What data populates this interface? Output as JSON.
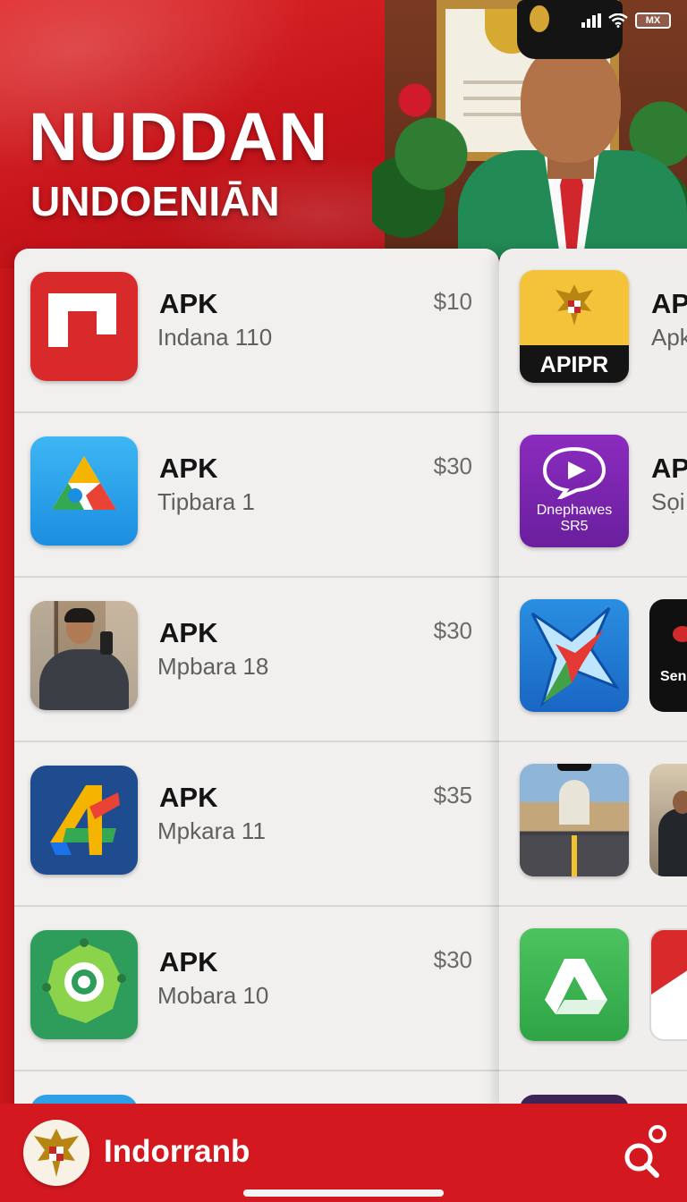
{
  "banner": {
    "title": "NUDDAN",
    "subtitle": "UNDOENIĀN"
  },
  "status_bar": {
    "battery_label": "MX"
  },
  "left_list": [
    {
      "title": "APK",
      "subtitle": "Indana 110",
      "price": "$10",
      "icon": "p-letter-icon"
    },
    {
      "title": "APK",
      "subtitle": "Tipbara 1",
      "price": "$30",
      "icon": "triangle-drive-icon"
    },
    {
      "title": "APK",
      "subtitle": "Mpbara 18",
      "price": "$30",
      "icon": "person-photo-icon"
    },
    {
      "title": "APK",
      "subtitle": "Mpkara 11",
      "price": "$35",
      "icon": "colorful-four-icon"
    },
    {
      "title": "APK",
      "subtitle": "Mobara 10",
      "price": "$30",
      "icon": "green-target-icon"
    }
  ],
  "right_list": [
    {
      "title": "AP",
      "subtitle": "Apk",
      "icon": "garuda-icon",
      "icon_text": "APIPR"
    },
    {
      "title": "AP",
      "subtitle": "Sọi",
      "icon": "purple-chat-icon",
      "icon_text_1": "Dnephawes",
      "icon_text_2": "SR5"
    },
    {
      "icon": "star-icon",
      "peek_text": "Sen",
      "peek_icon": "black-app-icon"
    },
    {
      "icon": "city-game-icon",
      "peek_icon": "photo-app-icon"
    },
    {
      "icon": "drive-icon",
      "peek_icon": "red-app-icon"
    }
  ],
  "bottom_bar": {
    "brand": "Indorranb",
    "search_icon": "search-icon",
    "emblem_icon": "garuda-emblem-icon"
  },
  "colors": {
    "primary_red": "#d3191f",
    "panel_bg": "#f1f0ee",
    "text_dark": "#141414",
    "text_muted": "#5f5f5f"
  }
}
